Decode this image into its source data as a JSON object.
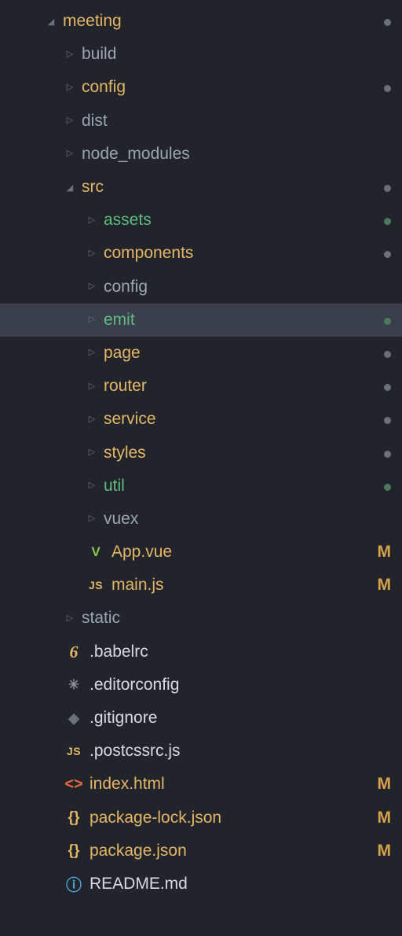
{
  "tree": [
    {
      "depth": 0,
      "type": "folder",
      "expanded": true,
      "label": "meeting",
      "color": "c-orange",
      "status": "dot",
      "dotColor": "dot-gray",
      "selected": false,
      "name": "folder-meeting"
    },
    {
      "depth": 1,
      "type": "folder",
      "expanded": false,
      "label": "build",
      "color": "c-gray",
      "status": "",
      "dotColor": "",
      "selected": false,
      "name": "folder-build"
    },
    {
      "depth": 1,
      "type": "folder",
      "expanded": false,
      "label": "config",
      "color": "c-orange",
      "status": "dot",
      "dotColor": "dot-gray",
      "selected": false,
      "name": "folder-config"
    },
    {
      "depth": 1,
      "type": "folder",
      "expanded": false,
      "label": "dist",
      "color": "c-gray",
      "status": "",
      "dotColor": "",
      "selected": false,
      "name": "folder-dist"
    },
    {
      "depth": 1,
      "type": "folder",
      "expanded": false,
      "label": "node_modules",
      "color": "c-gray",
      "status": "",
      "dotColor": "",
      "selected": false,
      "name": "folder-node-modules"
    },
    {
      "depth": 1,
      "type": "folder",
      "expanded": true,
      "label": "src",
      "color": "c-orange",
      "status": "dot",
      "dotColor": "dot-gray",
      "selected": false,
      "name": "folder-src"
    },
    {
      "depth": 2,
      "type": "folder",
      "expanded": false,
      "label": "assets",
      "color": "c-green",
      "status": "dot",
      "dotColor": "dot-green",
      "selected": false,
      "name": "folder-assets"
    },
    {
      "depth": 2,
      "type": "folder",
      "expanded": false,
      "label": "components",
      "color": "c-orange",
      "status": "dot",
      "dotColor": "dot-gray",
      "selected": false,
      "name": "folder-components"
    },
    {
      "depth": 2,
      "type": "folder",
      "expanded": false,
      "label": "config",
      "color": "c-gray",
      "status": "",
      "dotColor": "",
      "selected": false,
      "name": "folder-src-config"
    },
    {
      "depth": 2,
      "type": "folder",
      "expanded": false,
      "label": "emit",
      "color": "c-green",
      "status": "dot",
      "dotColor": "dot-green",
      "selected": true,
      "name": "folder-emit"
    },
    {
      "depth": 2,
      "type": "folder",
      "expanded": false,
      "label": "page",
      "color": "c-orange",
      "status": "dot",
      "dotColor": "dot-gray",
      "selected": false,
      "name": "folder-page"
    },
    {
      "depth": 2,
      "type": "folder",
      "expanded": false,
      "label": "router",
      "color": "c-orange",
      "status": "dot",
      "dotColor": "dot-gray",
      "selected": false,
      "name": "folder-router"
    },
    {
      "depth": 2,
      "type": "folder",
      "expanded": false,
      "label": "service",
      "color": "c-orange",
      "status": "dot",
      "dotColor": "dot-gray",
      "selected": false,
      "name": "folder-service"
    },
    {
      "depth": 2,
      "type": "folder",
      "expanded": false,
      "label": "styles",
      "color": "c-orange",
      "status": "dot",
      "dotColor": "dot-gray",
      "selected": false,
      "name": "folder-styles"
    },
    {
      "depth": 2,
      "type": "folder",
      "expanded": false,
      "label": "util",
      "color": "c-green",
      "status": "dot",
      "dotColor": "dot-green",
      "selected": false,
      "name": "folder-util"
    },
    {
      "depth": 2,
      "type": "folder",
      "expanded": false,
      "label": "vuex",
      "color": "c-gray",
      "status": "",
      "dotColor": "",
      "selected": false,
      "name": "folder-vuex"
    },
    {
      "depth": 2,
      "type": "file",
      "icon": "vue",
      "label": "App.vue",
      "color": "c-orange",
      "status": "M",
      "dotColor": "",
      "selected": false,
      "name": "file-app-vue"
    },
    {
      "depth": 2,
      "type": "file",
      "icon": "js",
      "label": "main.js",
      "color": "c-orange",
      "status": "M",
      "dotColor": "",
      "selected": false,
      "name": "file-main-js"
    },
    {
      "depth": 1,
      "type": "folder",
      "expanded": false,
      "label": "static",
      "color": "c-gray",
      "status": "",
      "dotColor": "",
      "selected": false,
      "name": "folder-static"
    },
    {
      "depth": 1,
      "type": "file",
      "icon": "babel",
      "label": ".babelrc",
      "color": "c-white",
      "status": "",
      "dotColor": "",
      "selected": false,
      "name": "file-babelrc"
    },
    {
      "depth": 1,
      "type": "file",
      "icon": "gear",
      "label": ".editorconfig",
      "color": "c-white",
      "status": "",
      "dotColor": "",
      "selected": false,
      "name": "file-editorconfig"
    },
    {
      "depth": 1,
      "type": "file",
      "icon": "git",
      "label": ".gitignore",
      "color": "c-white",
      "status": "",
      "dotColor": "",
      "selected": false,
      "name": "file-gitignore"
    },
    {
      "depth": 1,
      "type": "file",
      "icon": "js",
      "label": ".postcssrc.js",
      "color": "c-white",
      "status": "",
      "dotColor": "",
      "selected": false,
      "name": "file-postcssrc"
    },
    {
      "depth": 1,
      "type": "file",
      "icon": "html",
      "label": "index.html",
      "color": "c-orange",
      "status": "M",
      "dotColor": "",
      "selected": false,
      "name": "file-index-html"
    },
    {
      "depth": 1,
      "type": "file",
      "icon": "json",
      "label": "package-lock.json",
      "color": "c-orange",
      "status": "M",
      "dotColor": "",
      "selected": false,
      "name": "file-package-lock"
    },
    {
      "depth": 1,
      "type": "file",
      "icon": "json",
      "label": "package.json",
      "color": "c-orange",
      "status": "M",
      "dotColor": "",
      "selected": false,
      "name": "file-package-json"
    },
    {
      "depth": 1,
      "type": "file",
      "icon": "info",
      "label": "README.md",
      "color": "c-white",
      "status": "",
      "dotColor": "",
      "selected": false,
      "name": "file-readme"
    }
  ],
  "icons": {
    "vue": {
      "glyph": "V",
      "cls": "ic-vue",
      "name": "vue-icon"
    },
    "js": {
      "glyph": "JS",
      "cls": "ic-js",
      "name": "js-icon"
    },
    "babel": {
      "glyph": "6",
      "cls": "ic-babel",
      "name": "babel-icon"
    },
    "gear": {
      "glyph": "✳",
      "cls": "ic-gear",
      "name": "gear-icon"
    },
    "git": {
      "glyph": "◆",
      "cls": "ic-git",
      "name": "git-icon"
    },
    "html": {
      "glyph": "<>",
      "cls": "ic-html",
      "name": "html-icon"
    },
    "json": {
      "glyph": "{}",
      "cls": "ic-json",
      "name": "json-icon"
    },
    "info": {
      "glyph": "ⓘ",
      "cls": "ic-info",
      "name": "info-icon"
    }
  }
}
